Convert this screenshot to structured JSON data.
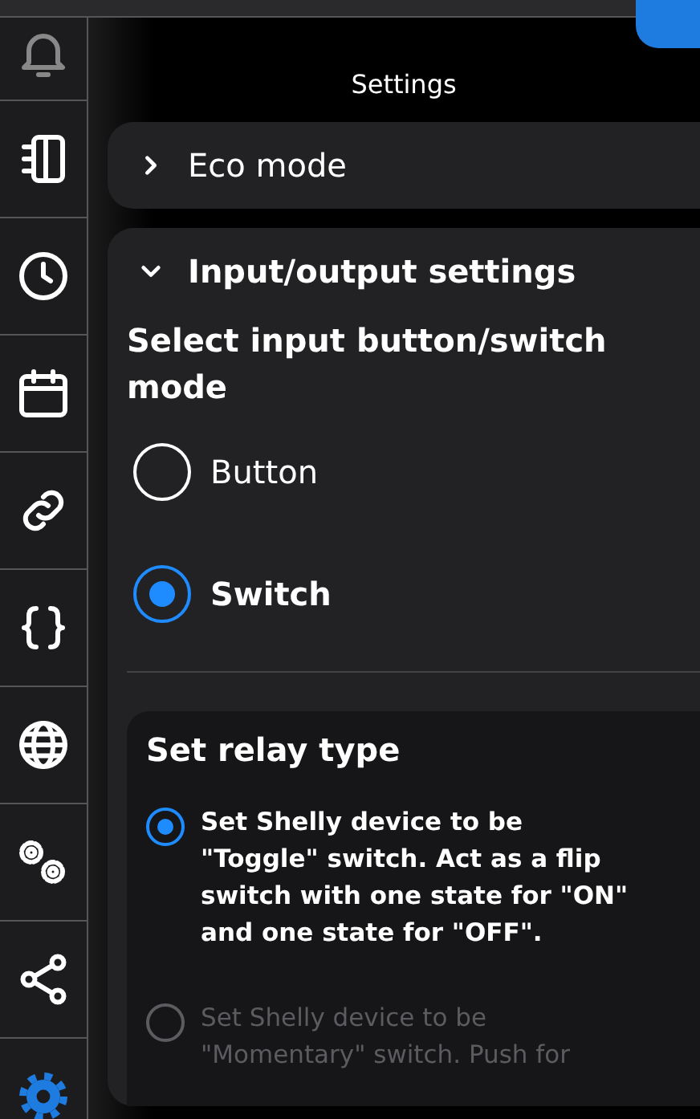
{
  "header": {
    "title": "Settings"
  },
  "sidebar": {
    "items": [
      {
        "selected": false,
        "disabled": true
      },
      {
        "selected": false,
        "disabled": false
      },
      {
        "selected": false,
        "disabled": false
      },
      {
        "selected": false,
        "disabled": false
      },
      {
        "selected": false,
        "disabled": false
      },
      {
        "selected": false,
        "disabled": false
      },
      {
        "selected": false,
        "disabled": false
      },
      {
        "selected": false,
        "disabled": false
      },
      {
        "selected": false,
        "disabled": false
      },
      {
        "selected": true,
        "disabled": false
      }
    ]
  },
  "sections": [
    {
      "title": "Eco mode",
      "expanded": false
    },
    {
      "title": "Input/output settings",
      "expanded": true,
      "input_mode": {
        "title": "Select input button/switch mode",
        "options": [
          {
            "label": "Button",
            "selected": false
          },
          {
            "label": "Switch",
            "selected": true
          }
        ]
      },
      "relay_type": {
        "title": "Set relay type",
        "options": [
          {
            "label": "Set Shelly device to be \"Toggle\" switch. Act as a flip switch with one state for \"ON\" and one state for \"OFF\".",
            "selected": true,
            "disabled": false
          },
          {
            "label": "Set Shelly device to be \"Momentary\" switch. Push for",
            "selected": false,
            "disabled": true
          }
        ]
      }
    }
  ]
}
